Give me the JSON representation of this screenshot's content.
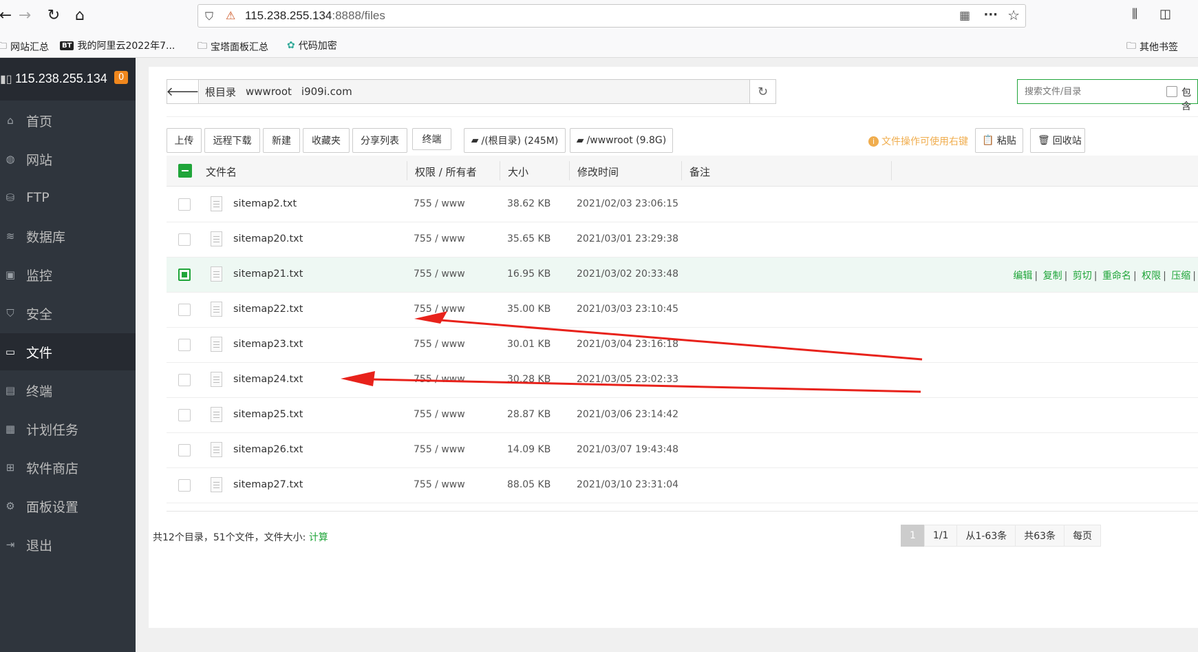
{
  "browser": {
    "url_host": "115.238.255.134",
    "url_port_path": ":8888/files"
  },
  "bookmarks": [
    {
      "label": "网站汇总"
    },
    {
      "label": "我的阿里云2022年7..."
    },
    {
      "label": "宝塔面板汇总"
    },
    {
      "label": "代码加密"
    },
    {
      "label": "其他书签"
    }
  ],
  "bookmark_bt": "BT",
  "sidebar": {
    "server_ip": "115.238.255.134",
    "badge": "0",
    "items": [
      {
        "label": "首页",
        "icon": "home-icon"
      },
      {
        "label": "网站",
        "icon": "globe-icon"
      },
      {
        "label": "FTP",
        "icon": "ftp-icon"
      },
      {
        "label": "数据库",
        "icon": "database-icon"
      },
      {
        "label": "监控",
        "icon": "monitor-icon"
      },
      {
        "label": "安全",
        "icon": "shield-icon"
      },
      {
        "label": "文件",
        "icon": "folder-icon",
        "active": true
      },
      {
        "label": "终端",
        "icon": "terminal-icon"
      },
      {
        "label": "计划任务",
        "icon": "calendar-icon"
      },
      {
        "label": "软件商店",
        "icon": "grid-icon"
      },
      {
        "label": "面板设置",
        "icon": "gear-icon"
      },
      {
        "label": "退出",
        "icon": "logout-icon"
      }
    ]
  },
  "path": {
    "crumbs": [
      "根目录",
      "wwwroot",
      "i909i.com"
    ]
  },
  "search": {
    "placeholder": "搜索文件/目录",
    "subdir_label": "包含"
  },
  "toolbar": {
    "upload": "上传",
    "remote_download": "远程下载",
    "new": "新建",
    "favorites": "收藏夹",
    "share_list": "分享列表",
    "terminal": "终端",
    "disk_root": "/(根目录) (245M)",
    "disk_www": "/wwwroot (9.8G)",
    "hint": "文件操作可使用右键",
    "paste": "粘贴",
    "recycle": "回收站"
  },
  "table": {
    "headers": {
      "name": "文件名",
      "perm": "权限 / 所有者",
      "size": "大小",
      "mtime": "修改时间",
      "note": "备注"
    },
    "rows": [
      {
        "name": "sitemap2.txt",
        "perm": "755 / www",
        "size": "38.62 KB",
        "mtime": "2021/02/03 23:06:15"
      },
      {
        "name": "sitemap20.txt",
        "perm": "755 / www",
        "size": "35.65 KB",
        "mtime": "2021/03/01 23:29:38"
      },
      {
        "name": "sitemap21.txt",
        "perm": "755 / www",
        "size": "16.95 KB",
        "mtime": "2021/03/02 20:33:48",
        "selected": true
      },
      {
        "name": "sitemap22.txt",
        "perm": "755 / www",
        "size": "35.00 KB",
        "mtime": "2021/03/03 23:10:45"
      },
      {
        "name": "sitemap23.txt",
        "perm": "755 / www",
        "size": "30.01 KB",
        "mtime": "2021/03/04 23:16:18"
      },
      {
        "name": "sitemap24.txt",
        "perm": "755 / www",
        "size": "30.28 KB",
        "mtime": "2021/03/05 23:02:33"
      },
      {
        "name": "sitemap25.txt",
        "perm": "755 / www",
        "size": "28.87 KB",
        "mtime": "2021/03/06 23:14:42"
      },
      {
        "name": "sitemap26.txt",
        "perm": "755 / www",
        "size": "14.09 KB",
        "mtime": "2021/03/07 19:43:48"
      },
      {
        "name": "sitemap27.txt",
        "perm": "755 / www",
        "size": "88.05 KB",
        "mtime": "2021/03/10 23:31:04"
      }
    ],
    "row_actions": [
      "编辑",
      "复制",
      "剪切",
      "重命名",
      "权限",
      "压缩"
    ]
  },
  "footer": {
    "summary": "共12个目录，51个文件，文件大小:",
    "calc": "计算",
    "pager": [
      "1",
      "1/1",
      "从1-63条",
      "共63条",
      "每页"
    ]
  },
  "colors": {
    "accent": "#20a53a",
    "sidebar_bg": "#2f353d",
    "annotation_arrow": "#e8221b"
  }
}
